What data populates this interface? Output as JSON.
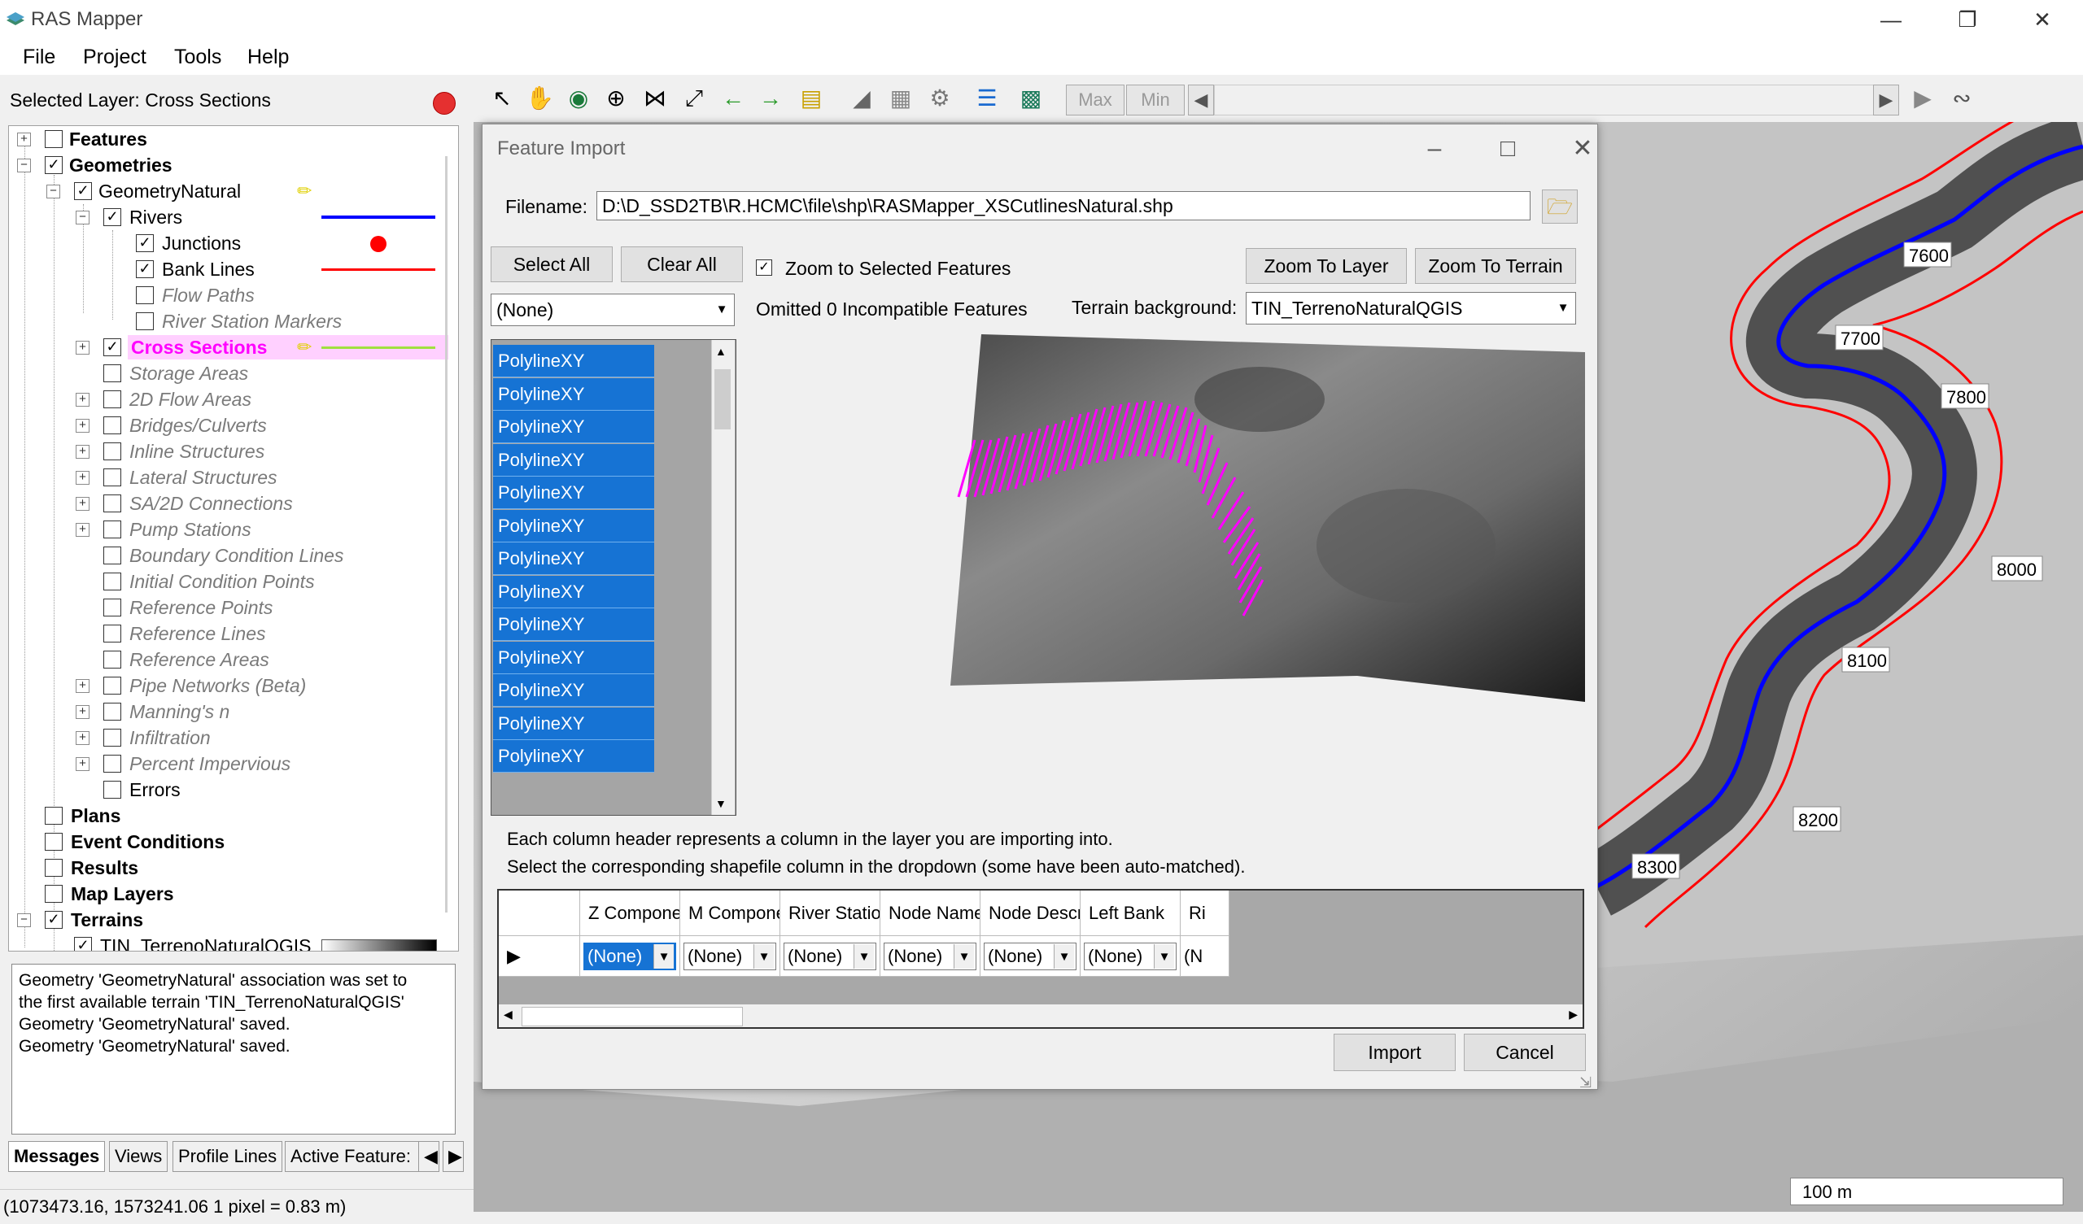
{
  "app": {
    "title": "RAS Mapper"
  },
  "menu": [
    "File",
    "Project",
    "Tools",
    "Help"
  ],
  "selected_layer": "Selected Layer: Cross Sections",
  "tree": {
    "features": "Features",
    "geometries": "Geometries",
    "geometry_natural": "GeometryNatural",
    "rivers": "Rivers",
    "junctions": "Junctions",
    "bank_lines": "Bank Lines",
    "flow_paths": "Flow Paths",
    "river_station_markers": "River Station Markers",
    "cross_sections": "Cross Sections",
    "storage_areas": "Storage Areas",
    "flow_areas_2d": "2D Flow Areas",
    "bridges": "Bridges/Culverts",
    "inline": "Inline Structures",
    "lateral": "Lateral Structures",
    "sa2d": "SA/2D Connections",
    "pump": "Pump Stations",
    "bc_lines": "Boundary Condition Lines",
    "ic_points": "Initial Condition Points",
    "ref_points": "Reference Points",
    "ref_lines": "Reference Lines",
    "ref_areas": "Reference Areas",
    "pipe": "Pipe Networks (Beta)",
    "mannings": "Manning's n",
    "infiltration": "Infiltration",
    "impervious": "Percent Impervious",
    "errors": "Errors",
    "plans": "Plans",
    "event_conditions": "Event Conditions",
    "results": "Results",
    "map_layers": "Map Layers",
    "terrains": "Terrains",
    "terrain_item": "TIN_TerrenoNaturalQGIS"
  },
  "messages": [
    "Geometry 'GeometryNatural' association was set to",
    "the first available terrain 'TIN_TerrenoNaturalQGIS'",
    "Geometry 'GeometryNatural' saved.",
    "Geometry 'GeometryNatural' saved."
  ],
  "tabs": [
    "Messages",
    "Views",
    "Profile Lines",
    "Active Feature:"
  ],
  "status": {
    "coords": "(1073473.16, 1573241.06  1 pixel = 0.83 m)"
  },
  "toolbar": {
    "max": "Max",
    "min": "Min"
  },
  "map": {
    "stations": [
      "7600",
      "7700",
      "7800",
      "8000",
      "8100",
      "8200",
      "8300"
    ],
    "scale": "100 m"
  },
  "dialog": {
    "title": "Feature Import",
    "filename_label": "Filename:",
    "filename": "D:\\D_SSD2TB\\R.HCMC\\file\\shp\\RASMapper_XSCutlinesNatural.shp",
    "select_all": "Select All",
    "clear_all": "Clear All",
    "zoom_selected": "Zoom to Selected Features",
    "zoom_layer": "Zoom To Layer",
    "zoom_terrain": "Zoom To Terrain",
    "filter_value": "(None)",
    "omitted": "Omitted 0 Incompatible Features",
    "terrain_label": "Terrain background:",
    "terrain_value": "TIN_TerrenoNaturalQGIS",
    "feature_item": "PolylineXY",
    "info1": "Each column header represents a column in the layer you are importing into.",
    "info2": "Select the corresponding shapefile column in the dropdown (some have been auto-matched).",
    "columns": [
      "Z Component",
      "M Component",
      "River Station",
      "Node Name",
      "Node Descriptions",
      "Left Bank",
      "Ri"
    ],
    "cell_value": "(None)",
    "cell_partial": "(N",
    "import": "Import",
    "cancel": "Cancel"
  },
  "colors": {
    "selection": "#1673d4",
    "cross_sections": "#ff00ff",
    "river": "#0000ff",
    "bank": "#ff0000"
  }
}
